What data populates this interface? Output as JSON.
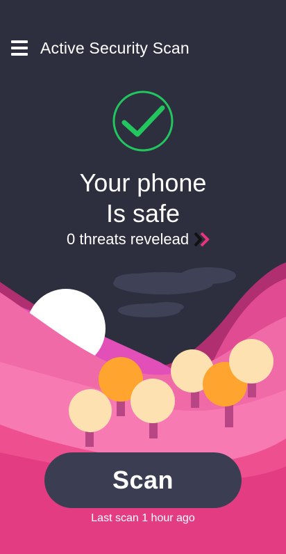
{
  "header": {
    "title": "Active Security Scan",
    "menu_icon": "hamburger-menu-icon"
  },
  "status": {
    "icon": "check-circle-icon",
    "line1": "Your phone",
    "line2": "Is safe",
    "threats_text": "0 threats revelead",
    "threats_icon": "double-chevron-right-icon"
  },
  "scan": {
    "button_label": "Scan",
    "last_scan": "Last scan 1 hour ago"
  },
  "colors": {
    "background": "#2d2f3e",
    "success": "#22c55e",
    "accent": "#e8337f",
    "button": "#3b3e52"
  }
}
